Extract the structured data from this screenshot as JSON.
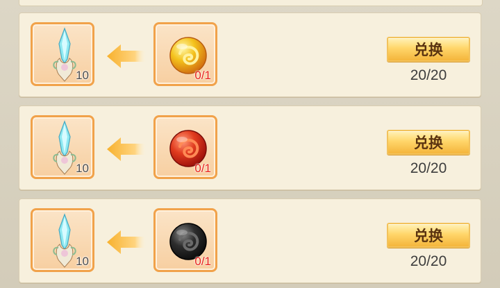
{
  "exchange": {
    "rows": [
      {
        "reward": {
          "icon": "crystal-icon",
          "quantity": "10"
        },
        "cost": {
          "icon": "orb-icon",
          "color": "#f4c21c",
          "secondary": "#d06b10",
          "quantity": "0/1"
        },
        "button": "兑换",
        "count": "20/20"
      },
      {
        "reward": {
          "icon": "crystal-icon",
          "quantity": "10"
        },
        "cost": {
          "icon": "orb-icon",
          "color": "#e13c1f",
          "secondary": "#9b0f0a",
          "quantity": "0/1"
        },
        "button": "兑换",
        "count": "20/20"
      },
      {
        "reward": {
          "icon": "crystal-icon",
          "quantity": "10"
        },
        "cost": {
          "icon": "orb-icon",
          "color": "#2d2d2d",
          "secondary": "#0c0c0c",
          "quantity": "0/1"
        },
        "button": "兑换",
        "count": "20/20"
      }
    ]
  }
}
